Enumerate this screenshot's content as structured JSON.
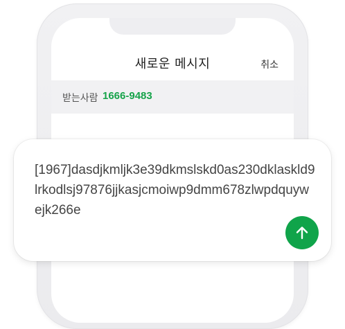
{
  "screen": {
    "title": "새로운 메시지",
    "cancel_label": "취소"
  },
  "recipient": {
    "label": "받는사람",
    "number": "1666-9483"
  },
  "message": {
    "text": "[1967]dasdjkmljk3e39dkmslskd0as230dklaskld9lrkodlsj97876jjkasjcmoiwp9dmm678zlwpdquywejk266e"
  },
  "icons": {
    "send": "arrow-up-icon"
  },
  "colors": {
    "accent": "#10a44a",
    "recipient_number": "#16a34a"
  }
}
